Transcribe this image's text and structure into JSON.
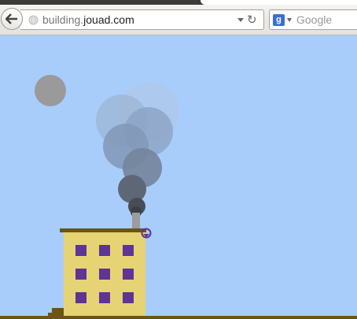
{
  "browser": {
    "url_prefix": "building.",
    "url_host": "jouad.com",
    "search_engine_letter": "g",
    "search_placeholder": "Google"
  },
  "colors": {
    "sky": "#a8cdfb",
    "building": "#e6d474",
    "windows": "#5e3494",
    "roof": "#6b5418",
    "ground": "#6b5418",
    "chimney": "#9c9c9c",
    "sun": "#9a9a9a",
    "smoke_dark": "#474d57"
  },
  "icons": {
    "back": "left-arrow-icon",
    "site": "globe-icon",
    "reload": "reload-icon",
    "search_engine": "google-g-icon"
  }
}
